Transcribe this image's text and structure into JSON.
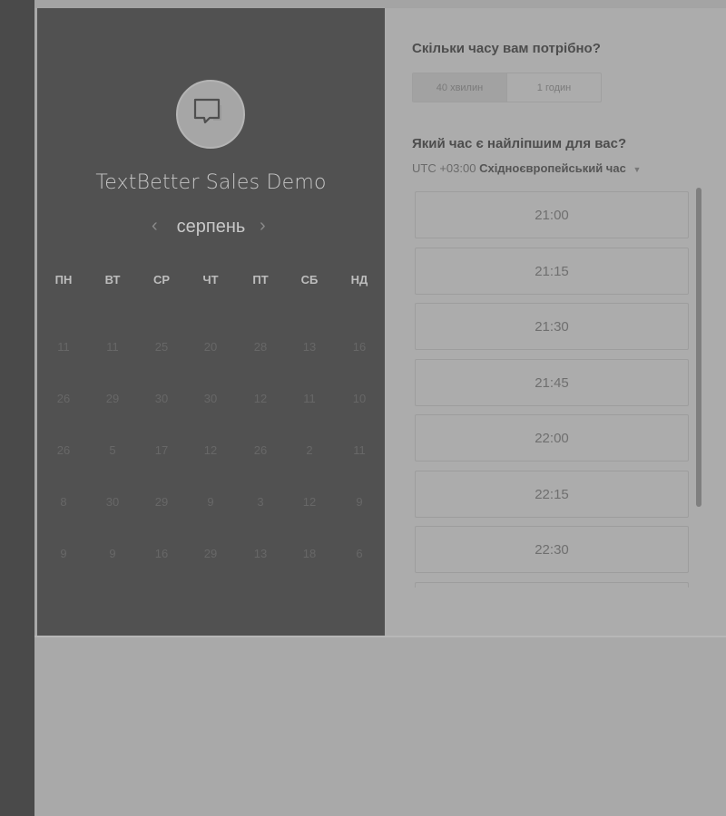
{
  "event": {
    "title": "TextBetter Sales Demo",
    "logo_icon": "chat-bubble-icon"
  },
  "calendar": {
    "month": "серпень",
    "prev_icon": "chevron-left-icon",
    "next_icon": "chevron-right-icon",
    "weekdays": [
      "ПН",
      "ВТ",
      "СР",
      "ЧТ",
      "ПТ",
      "СБ",
      "НД"
    ],
    "weeks": [
      [
        "11",
        "11",
        "25",
        "20",
        "28",
        "13",
        "16"
      ],
      [
        "26",
        "29",
        "30",
        "30",
        "12",
        "11",
        "10"
      ],
      [
        "26",
        "5",
        "17",
        "12",
        "26",
        "2",
        "11"
      ],
      [
        "8",
        "30",
        "29",
        "9",
        "3",
        "12",
        "9"
      ],
      [
        "9",
        "9",
        "16",
        "29",
        "13",
        "18",
        "6"
      ]
    ]
  },
  "duration": {
    "question": "Скільки часу вам потрібно?",
    "options": [
      "40 хвилин",
      "1 годин"
    ],
    "selected": "40 хвилин"
  },
  "time_selection": {
    "question": "Який час є найліпшим для вас?",
    "timezone_offset": "UTC +03:00",
    "timezone_name": "Східноєвропейський час",
    "slots": [
      "21:00",
      "21:15",
      "21:30",
      "21:45",
      "22:00",
      "22:15",
      "22:30"
    ]
  }
}
